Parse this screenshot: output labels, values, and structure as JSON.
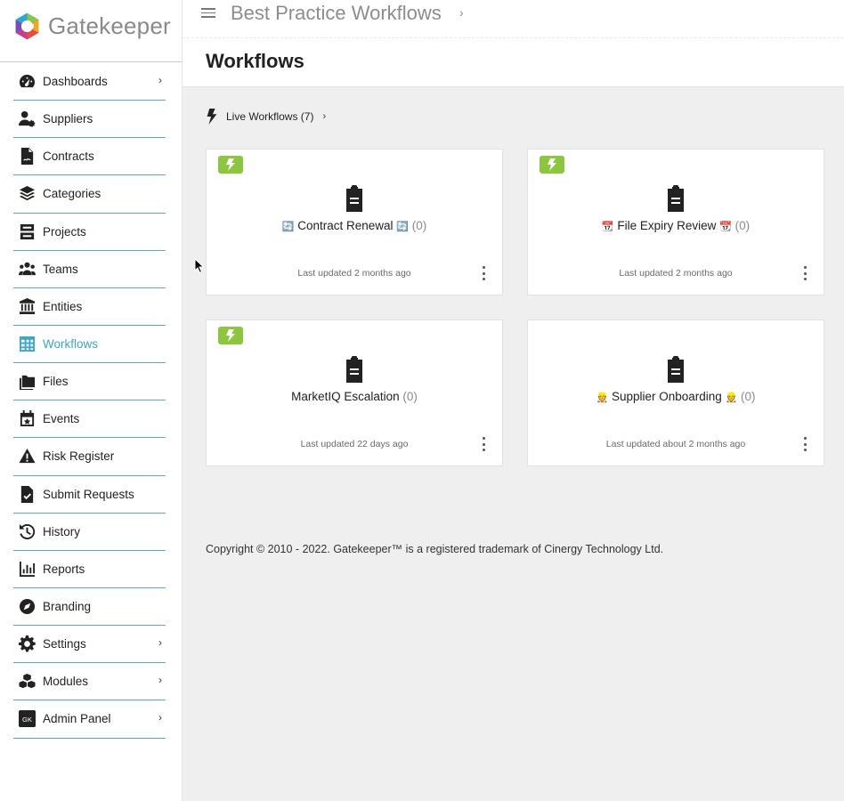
{
  "brand": {
    "name": "Gatekeeper"
  },
  "header": {
    "breadcrumb": "Best Practice Workflows",
    "page_title": "Workflows"
  },
  "sidebar": {
    "items": [
      {
        "label": "Dashboards",
        "icon": "dashboard-icon",
        "chevron": true
      },
      {
        "label": "Suppliers",
        "icon": "supplier-icon",
        "chevron": false
      },
      {
        "label": "Contracts",
        "icon": "contract-icon",
        "chevron": false
      },
      {
        "label": "Categories",
        "icon": "layers-icon",
        "chevron": false
      },
      {
        "label": "Projects",
        "icon": "projects-icon",
        "chevron": false
      },
      {
        "label": "Teams",
        "icon": "teams-icon",
        "chevron": false
      },
      {
        "label": "Entities",
        "icon": "bank-icon",
        "chevron": false
      },
      {
        "label": "Workflows",
        "icon": "table-icon",
        "chevron": false,
        "active": true
      },
      {
        "label": "Files",
        "icon": "folder-icon",
        "chevron": false
      },
      {
        "label": "Events",
        "icon": "calendar-icon",
        "chevron": false
      },
      {
        "label": "Risk Register",
        "icon": "warning-icon",
        "chevron": false
      },
      {
        "label": "Submit Requests",
        "icon": "file-check-icon",
        "chevron": false
      },
      {
        "label": "History",
        "icon": "history-icon",
        "chevron": false
      },
      {
        "label": "Reports",
        "icon": "chart-icon",
        "chevron": false
      },
      {
        "label": "Branding",
        "icon": "compass-icon",
        "chevron": false
      },
      {
        "label": "Settings",
        "icon": "gear-icon",
        "chevron": true
      },
      {
        "label": "Modules",
        "icon": "cubes-icon",
        "chevron": true
      },
      {
        "label": "Admin Panel",
        "icon": "gk-badge-icon",
        "chevron": true
      }
    ]
  },
  "main": {
    "live_workflows_label": "Live Workflows (7)",
    "cards": [
      {
        "name": "Contract Renewal",
        "emoji": "🔄",
        "count": "(0)",
        "updated": "Last updated 2 months ago",
        "live": true
      },
      {
        "name": "File Expiry Review",
        "emoji": "📆",
        "count": "(0)",
        "updated": "Last updated 2 months ago",
        "live": true
      },
      {
        "name": "MarketIQ Escalation",
        "emoji": "",
        "count": "(0)",
        "updated": "Last updated 22 days ago",
        "live": true
      },
      {
        "name": "Supplier Onboarding",
        "emoji": "👷",
        "count": "(0)",
        "updated": "Last updated about 2 months ago",
        "live": false
      }
    ]
  },
  "footer": {
    "copyright": "Copyright © 2010 - 2022. Gatekeeper™ is a registered trademark of Cinergy Technology Ltd."
  },
  "colors": {
    "accent": "#3fa6c7",
    "live_badge": "#8cc63f",
    "background": "#efefef"
  }
}
